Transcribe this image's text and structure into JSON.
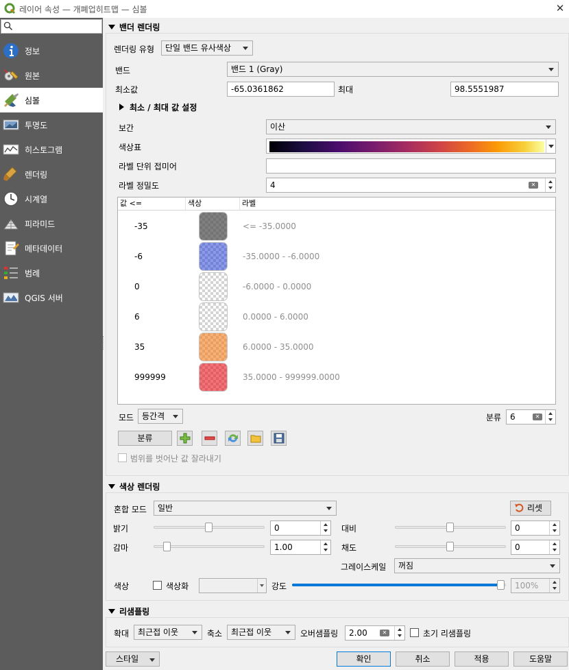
{
  "window": {
    "title": "레이어 속성 — 개폐업히트맵 — 심볼",
    "close_glyph": "✕"
  },
  "sidebar": {
    "search_placeholder": "",
    "items": [
      {
        "label": "정보",
        "icon": "info-icon"
      },
      {
        "label": "원본",
        "icon": "source-icon"
      },
      {
        "label": "심볼",
        "icon": "symbology-icon",
        "selected": true
      },
      {
        "label": "투명도",
        "icon": "transparency-icon"
      },
      {
        "label": "히스토그램",
        "icon": "histogram-icon"
      },
      {
        "label": "렌더링",
        "icon": "rendering-icon"
      },
      {
        "label": "시계열",
        "icon": "temporal-icon"
      },
      {
        "label": "피라미드",
        "icon": "pyramids-icon"
      },
      {
        "label": "메타데이터",
        "icon": "metadata-icon"
      },
      {
        "label": "범례",
        "icon": "legend-icon"
      },
      {
        "label": "QGIS 서버",
        "icon": "qgis-server-icon"
      }
    ]
  },
  "band_rendering": {
    "header": "밴더 렌더링",
    "render_type_label": "렌더링 유형",
    "render_type_value": "단일 밴드 유사색상",
    "band_label": "밴드",
    "band_value": "밴드 1 (Gray)",
    "min_label": "최소값",
    "min_value": "-65.0361862",
    "max_label": "최대",
    "max_value": "98.5551987",
    "minmax_settings": "최소 / 최대 값 설정",
    "interp_label": "보간",
    "interp_value": "이산",
    "ramp_label": "색상표",
    "suffix_label": "라벨 단위 접미어",
    "suffix_value": "",
    "precision_label": "라벨 정밀도",
    "precision_value": "4",
    "columns": {
      "value": "값 <=",
      "color": "색상",
      "label": "라벨"
    },
    "classes": [
      {
        "value": "-35",
        "label": "<= -35.0000",
        "color": "#555555"
      },
      {
        "value": "-6",
        "label": "-35.0000 - -6.0000",
        "color": "#2b45d8"
      },
      {
        "value": "0",
        "label": "-6.0000 - 0.0000",
        "color": "#ffffff"
      },
      {
        "value": "6",
        "label": "0.0000 - 6.0000",
        "color": "#ffffff"
      },
      {
        "value": "35",
        "label": "6.0000 - 35.0000",
        "color": "#f6852b"
      },
      {
        "value": "999999",
        "label": "35.0000 - 999999.0000",
        "color": "#ec1c24"
      }
    ],
    "mode_label": "모드",
    "mode_value": "등간격",
    "classes_label": "분류",
    "classes_count": "6",
    "classify_button": "분류",
    "clip_label": "범위를 벗어난 값 잘라내기"
  },
  "color_rendering": {
    "header": "색상 렌더링",
    "blend_label": "혼합 모드",
    "blend_value": "일반",
    "reset_button": "리셋",
    "brightness_label": "밝기",
    "brightness_value": "0",
    "contrast_label": "대비",
    "contrast_value": "0",
    "gamma_label": "감마",
    "gamma_value": "1.00",
    "saturation_label": "채도",
    "saturation_value": "0",
    "grayscale_label": "그레이스케일",
    "grayscale_value": "꺼짐",
    "hue_label": "색상",
    "colorize_label": "색상화",
    "strength_label": "강도",
    "strength_value": "100%"
  },
  "resampling": {
    "header": "리샘플링",
    "zoom_in_label": "확대",
    "zoom_in_value": "최근접 이웃",
    "zoom_out_label": "축소",
    "zoom_out_value": "최근접 이웃",
    "oversampling_label": "오버샘플링",
    "oversampling_value": "2.00",
    "early_label": "초기 리샘플링"
  },
  "footer": {
    "style_button": "스타일",
    "ok_button": "확인",
    "cancel_button": "취소",
    "apply_button": "적용",
    "help_button": "도움말"
  },
  "colors": {
    "accent": "#0078d7",
    "sidebar_bg": "#5c5c5c",
    "qgis_green": "#589632"
  }
}
